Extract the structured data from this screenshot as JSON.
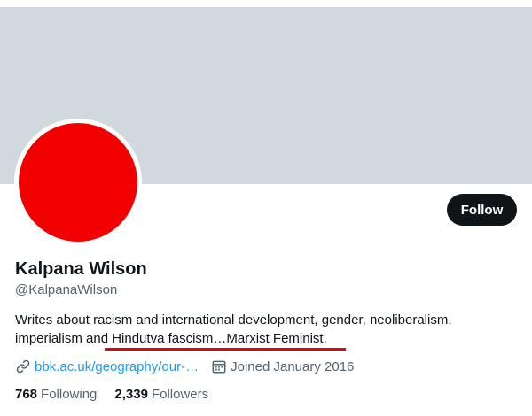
{
  "top_strip": {
    "text": "··· ·· ·"
  },
  "profile": {
    "name": "Kalpana Wilson",
    "handle": "@KalpanaWilson",
    "bio_lines": [
      "Writes about racism and international development, gender, neoliberalism,",
      "imperialism and Hindutva fascism…Marxist Feminist."
    ],
    "website": "bbk.ac.uk/geography/our-…",
    "joined": "Joined January 2016",
    "following_count": "768",
    "following_label": "Following",
    "followers_count": "2,339",
    "followers_label": "Followers"
  },
  "follow_button": {
    "label": "Follow"
  },
  "colors": {
    "banner": "#cfd9de",
    "avatar": "#f20000",
    "annotation_underline": "#e0050f",
    "link": "#1d9bf0"
  },
  "icons": {
    "website": "link-icon",
    "joined": "calendar-icon"
  }
}
